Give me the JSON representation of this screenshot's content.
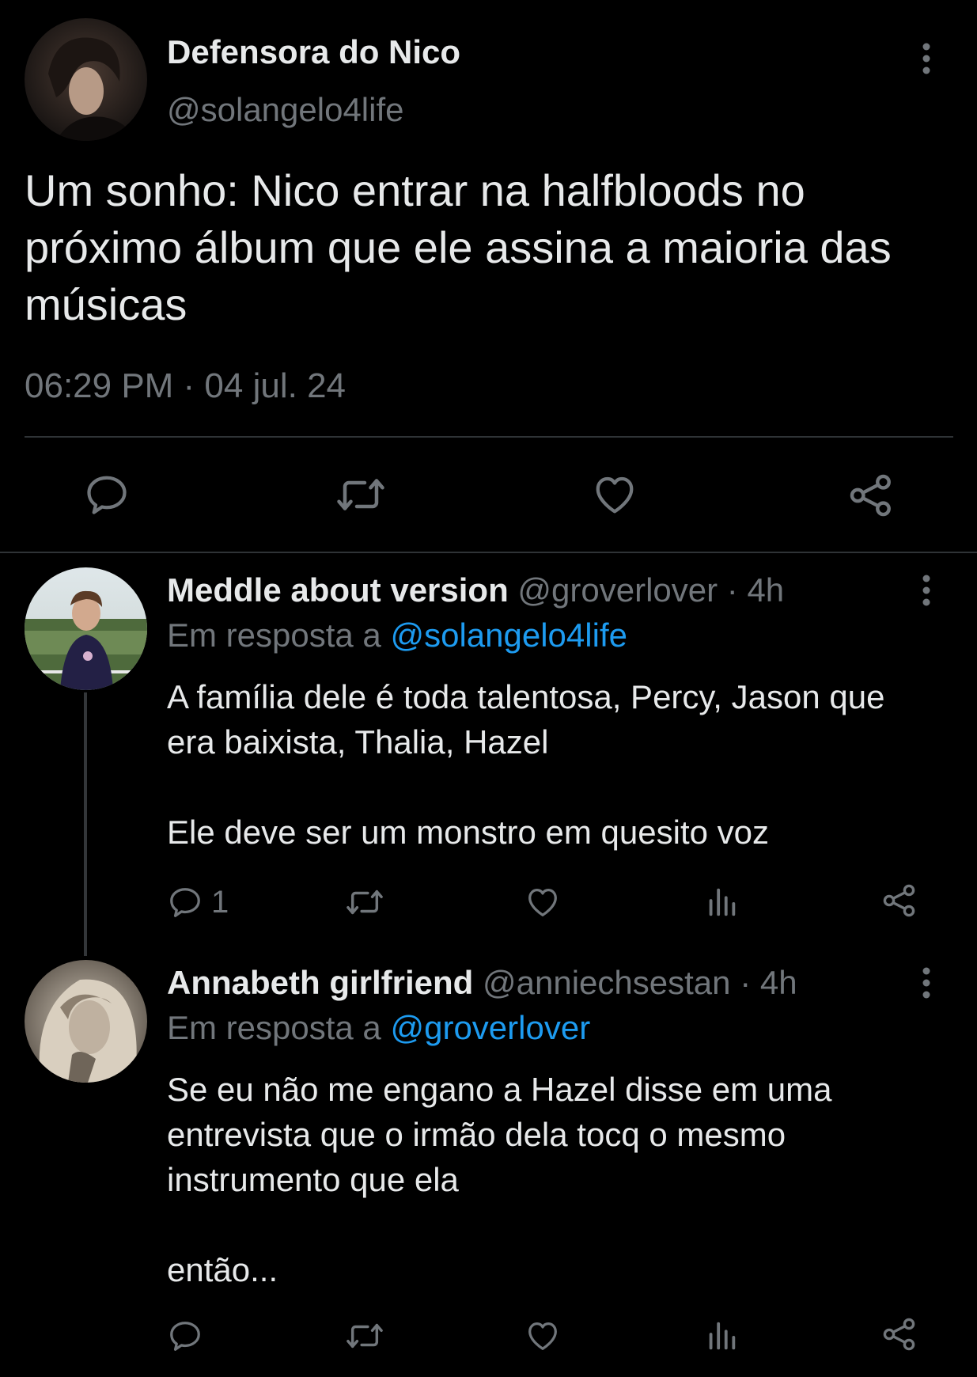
{
  "main_tweet": {
    "display_name": "Defensora do Nico",
    "handle": "@solangelo4life",
    "text": "Um sonho: Nico entrar na halfbloods no próximo álbum que ele assina a maioria das músicas",
    "timestamp": "06:29 PM · 04 jul. 24",
    "actions": {
      "reply_icon": "reply-icon",
      "retweet_icon": "retweet-icon",
      "like_icon": "heart-icon",
      "share_icon": "share-icon"
    }
  },
  "replies": [
    {
      "display_name": "Meddle about version",
      "handle": "@groverlover",
      "time": "· 4h",
      "reply_prefix": "Em resposta a ",
      "reply_to": "@solangelo4life",
      "text": "A família dele é toda talentosa, Percy, Jason que era baixista, Thalia, Hazel\n\nEle deve ser um monstro em quesito voz",
      "reply_count": "1"
    },
    {
      "display_name": "Annabeth girlfriend",
      "handle": "@anniechsestan",
      "time": "· 4h",
      "reply_prefix": "Em resposta a ",
      "reply_to": "@groverlover",
      "text": "Se eu não me engano a Hazel disse em uma entrevista que o irmão dela tocq o mesmo instrumento que ela\n\nentão..."
    }
  ],
  "colors": {
    "background": "#000000",
    "text": "#e7e9ea",
    "secondary": "#71767b",
    "link": "#1d9bf0",
    "divider": "#2f3336"
  }
}
